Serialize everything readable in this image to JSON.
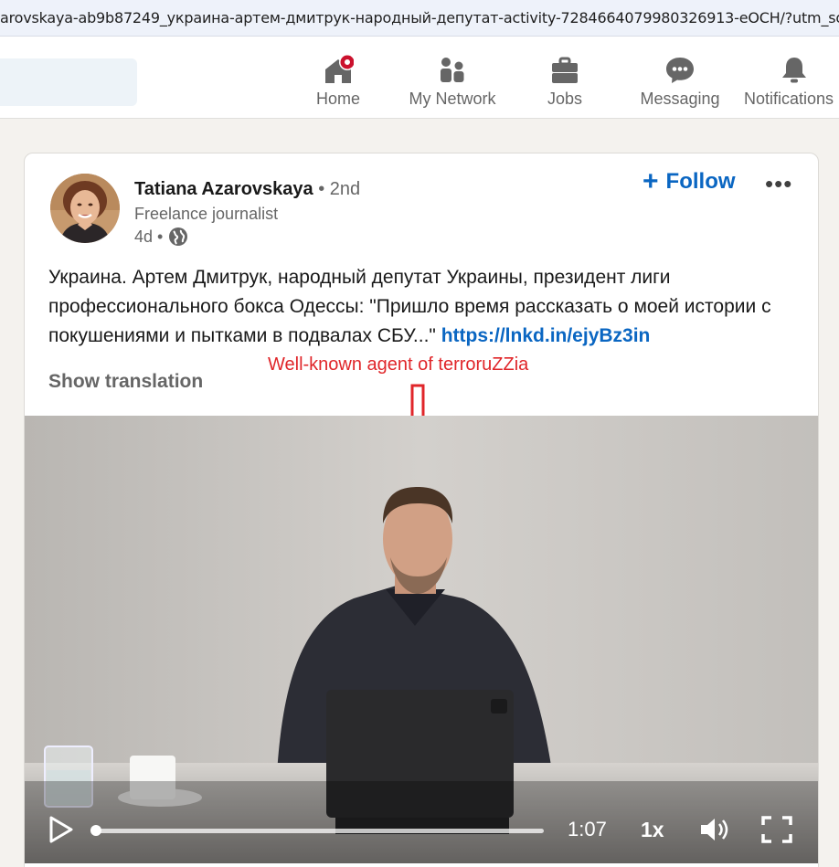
{
  "browser": {
    "url": "arovskaya-ab9b87249_украина-артем-дмитрук-народный-депутат-activity-7284664079980326913-eOCH/?utm_source"
  },
  "nav": {
    "items": [
      {
        "label": "Home",
        "icon": "home-icon"
      },
      {
        "label": "My Network",
        "icon": "people-icon"
      },
      {
        "label": "Jobs",
        "icon": "briefcase-icon"
      },
      {
        "label": "Messaging",
        "icon": "chat-bubble-icon"
      },
      {
        "label": "Notifications",
        "icon": "bell-icon"
      }
    ]
  },
  "post": {
    "author_name": "Tatiana Azarovskaya",
    "degree": "• 2nd",
    "headline": "Freelance journalist",
    "age": "4d •",
    "follow_label": "Follow",
    "more_label": "•••",
    "text": "Украина. Артем Дмитрук, народный депутат Украины, президент лиги профессионального бокса Одессы:  \"Пришло время рассказать о моей истории с покушениями и пытками в подвалах СБУ...\" ",
    "link": "https://lnkd.in/ejyBz3in",
    "show_translation": "Show translation",
    "annotation": "Well-known agent of terroruZZia"
  },
  "video": {
    "time_remaining": "1:07",
    "speed": "1x",
    "progress_fraction": 0.0
  },
  "colors": {
    "accent": "#0a66c2",
    "annotation": "#e0262a",
    "notification_badge": "#cb112d"
  }
}
